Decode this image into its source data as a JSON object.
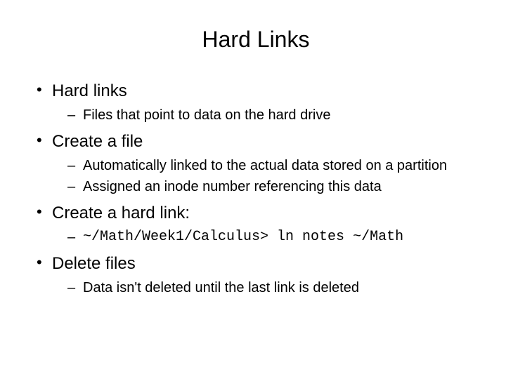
{
  "title": "Hard Links",
  "b1": {
    "text": "Hard links",
    "s1": "Files that point to data on the hard drive"
  },
  "b2": {
    "text": "Create a file",
    "s1": "Automatically linked to the actual data stored on a partition",
    "s2": "Assigned an inode number referencing this data"
  },
  "b3": {
    "text": "Create a hard link:",
    "s1": "~/Math/Week1/Calculus> ln notes ~/Math"
  },
  "b4": {
    "text": "Delete files",
    "s1": "Data isn't deleted until the last link is deleted"
  }
}
